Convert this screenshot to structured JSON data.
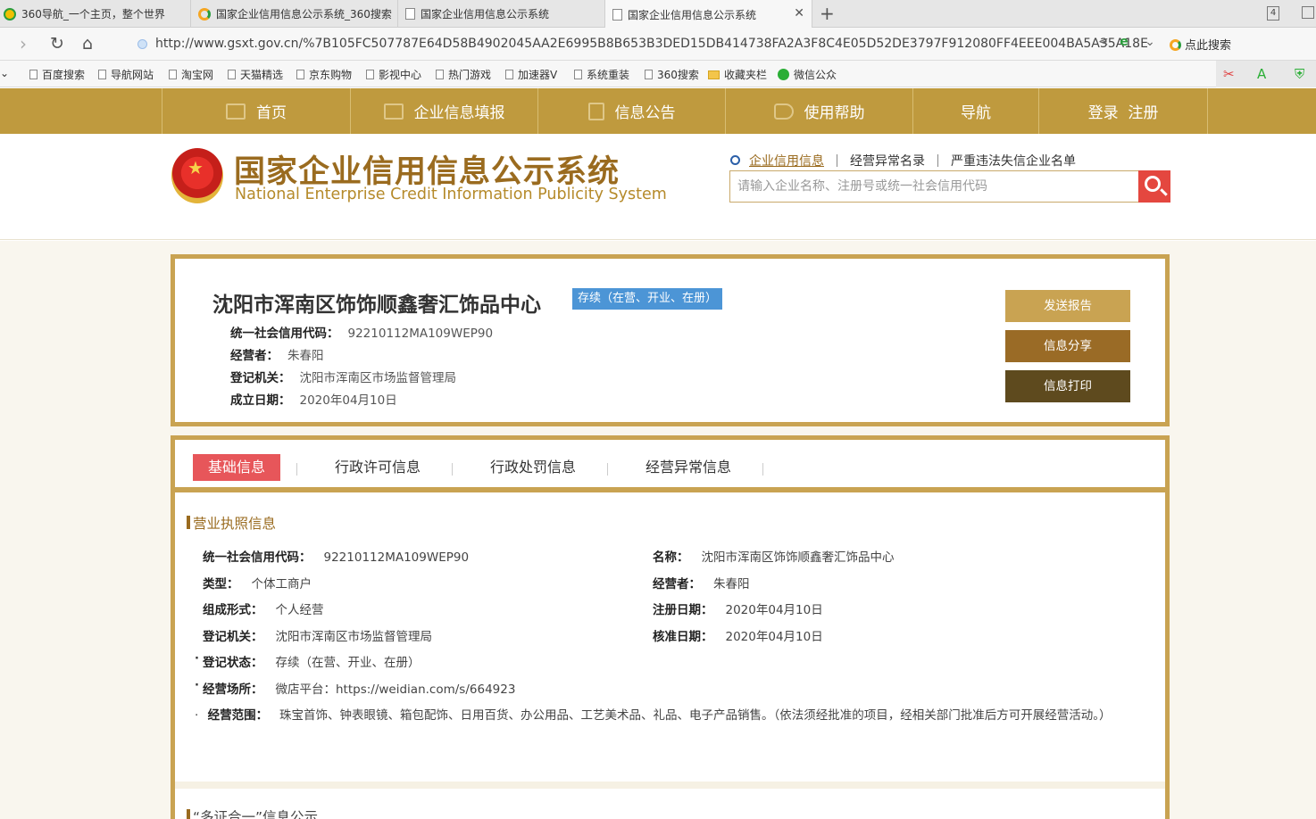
{
  "browser": {
    "tabs": [
      {
        "title": "360导航_一个主页，整个世界",
        "icon": "360-icon"
      },
      {
        "title": "国家企业信用信息公示系统_360搜索",
        "icon": "360-search-icon"
      },
      {
        "title": "国家企业信用信息公示系统",
        "icon": "page-icon"
      },
      {
        "title": "国家企业信用信息公示系统",
        "icon": "page-icon"
      }
    ],
    "tab_count": "4",
    "url": "http://www.gsxt.gov.cn/%7B105FC507787E64D58B4902045AA2E6995B8B653B3DED15DB414738FA2A3F8C4E05D52DE3797F912080FF4EEE004BA5A35A18E5E",
    "search_label": "点此搜索",
    "bookmarks": [
      "百度搜索",
      "导航网站",
      "淘宝网",
      "天猫精选",
      "京东购物",
      "影视中心",
      "热门游戏",
      "加速器V",
      "系统重装",
      "360搜索",
      "收藏夹栏",
      "微信公众"
    ]
  },
  "site_nav": [
    "首页",
    "企业信息填报",
    "信息公告",
    "使用帮助",
    "导航",
    "登录  注册"
  ],
  "header": {
    "title_cn": "国家企业信用信息公示系统",
    "title_en": "National Enterprise Credit Information Publicity System",
    "search_tabs": [
      "企业信用信息",
      "经营异常名录",
      "严重违法失信企业名单"
    ],
    "search_placeholder": "请输入企业名称、注册号或统一社会信用代码"
  },
  "company": {
    "name": "沈阳市浑南区饰饰顺鑫奢汇饰品中心",
    "status": "存续（在营、开业、在册）",
    "fields": [
      {
        "label": "统一社会信用代码：",
        "value": "92210112MA109WEP90"
      },
      {
        "label": "经营者：",
        "value": "朱春阳"
      },
      {
        "label": "登记机关：",
        "value": "沈阳市浑南区市场监督管理局"
      },
      {
        "label": "成立日期：",
        "value": "2020年04月10日"
      }
    ],
    "actions": [
      {
        "label": "发送报告",
        "color": "#c9a352"
      },
      {
        "label": "信息分享",
        "color": "#9a6b26"
      },
      {
        "label": "信息打印",
        "color": "#5e4a1e"
      }
    ]
  },
  "detail_tabs": [
    "基础信息",
    "行政许可信息",
    "行政处罚信息",
    "经营异常信息"
  ],
  "license": {
    "section_title": "营业执照信息",
    "left": [
      {
        "label": "统一社会信用代码：",
        "value": "92210112MA109WEP90"
      },
      {
        "label": "类型：",
        "value": "个体工商户"
      },
      {
        "label": "组成形式：",
        "value": "个人经营"
      },
      {
        "label": "登记机关：",
        "value": "沈阳市浑南区市场监督管理局"
      },
      {
        "label": "登记状态：",
        "value": "存续（在营、开业、在册）"
      },
      {
        "label": "经营场所：",
        "value": "微店平台：https://weidian.com/s/664923"
      }
    ],
    "right": [
      {
        "label": "名称：",
        "value": "沈阳市浑南区饰饰顺鑫奢汇饰品中心"
      },
      {
        "label": "经营者：",
        "value": "朱春阳"
      },
      {
        "label": "注册日期：",
        "value": "2020年04月10日"
      },
      {
        "label": "核准日期：",
        "value": "2020年04月10日"
      }
    ],
    "scope_label": "经营范围：",
    "scope_value": "珠宝首饰、钟表眼镜、箱包配饰、日用百货、办公用品、工艺美术品、礼品、电子产品销售。（依法须经批准的项目，经相关部门批准后方可开展经营活动。）"
  },
  "next_section_title": "“多证合一”信息公示",
  "colors": {
    "gold": "#bf9a3e",
    "border": "#c9a352",
    "accent_red": "#e7565a",
    "status_blue": "#4c95d6"
  }
}
